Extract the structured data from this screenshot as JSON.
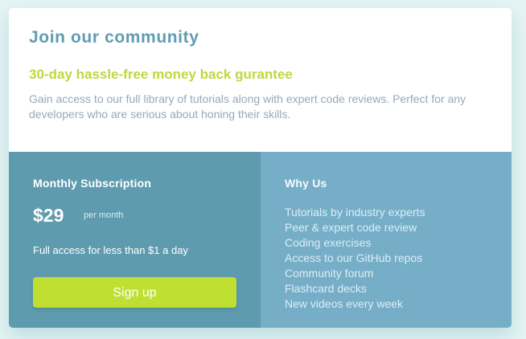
{
  "card": {
    "title": "Join our community",
    "subtitle": "30-day hassle-free money back gurantee",
    "description": "Gain access to our full library of tutorials along with expert code reviews. Perfect for any developers who are serious about honing their skills."
  },
  "subscription": {
    "heading": "Monthly Subscription",
    "price": "$29",
    "period": "per month",
    "access_text": "Full access for less than $1 a day",
    "cta_label": "Sign up"
  },
  "why_us": {
    "heading": "Why Us",
    "items": [
      "Tutorials by industry experts",
      "Peer & expert code review",
      "Coding exercises",
      "Access to our GitHub repos",
      "Community forum",
      "Flashcard decks",
      "New videos every week"
    ]
  },
  "colors": {
    "page_background": "#e6f4f5",
    "title": "#5f9cb2",
    "accent": "#bfd83c",
    "subscription_panel": "#5e9bae",
    "why_panel": "#76aec8",
    "button": "#bfe031"
  }
}
